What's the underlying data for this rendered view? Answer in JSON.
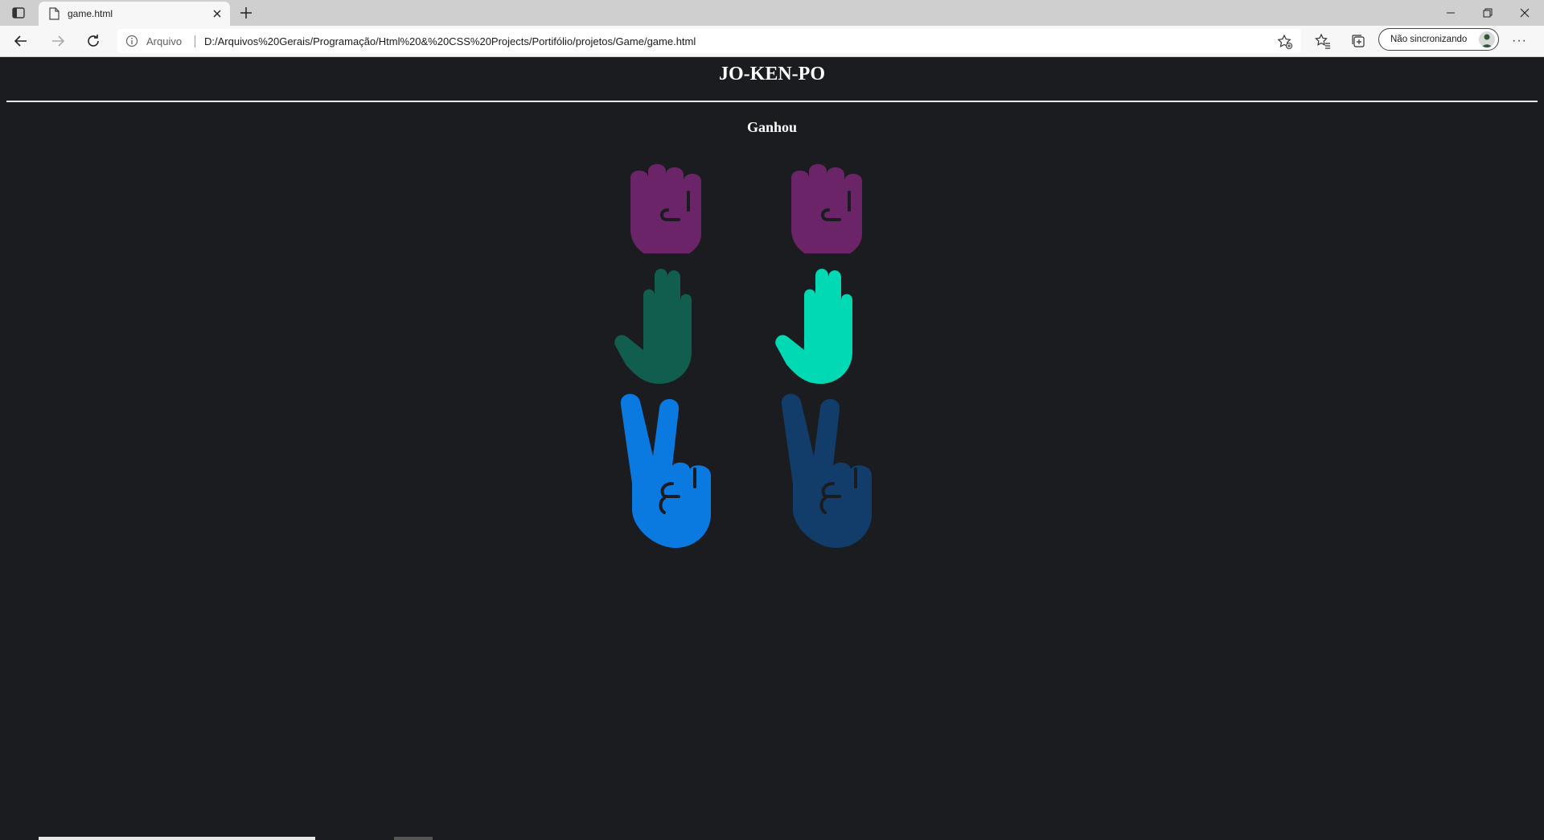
{
  "browser": {
    "tab_title": "game.html",
    "scheme_label": "Arquivo",
    "url": "D:/Arquivos%20Gerais/Programação/Html%20&%20CSS%20Projects/Portifólio/projetos/Game/game.html",
    "profile_label": "Não sincronizando",
    "more_label": "···"
  },
  "game": {
    "title": "JO-KEN-PO",
    "result": "Ganhou",
    "player_colors": {
      "rock": "#6b2468",
      "paper": "#115e4e",
      "scissors": "#0a7ae0"
    },
    "cpu_colors": {
      "rock": "#6b2468",
      "paper": "#00d9b4",
      "scissors": "#123d6b"
    }
  },
  "icons": [
    "tab-actions-icon",
    "page-icon",
    "close-icon",
    "plus-icon",
    "minimize-icon",
    "restore-icon",
    "window-close-icon",
    "back-icon",
    "forward-icon",
    "refresh-icon",
    "info-icon",
    "add-favorite-icon",
    "favorites-icon",
    "collections-icon",
    "avatar-icon"
  ]
}
